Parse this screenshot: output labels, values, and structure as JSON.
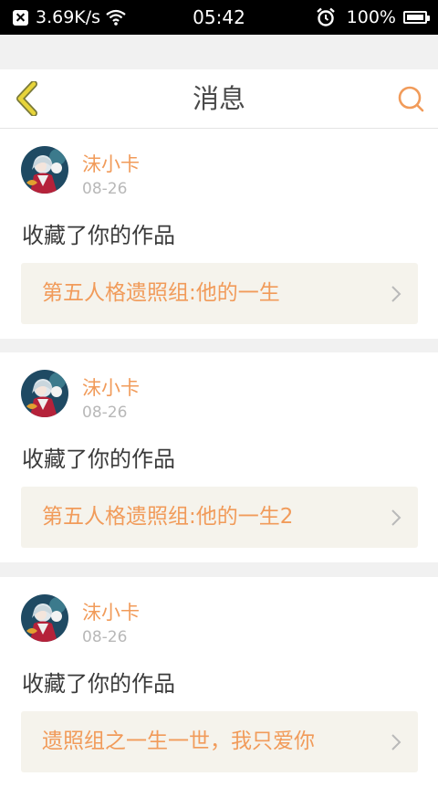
{
  "status_bar": {
    "speed": "3.69K/s",
    "time": "05:42",
    "battery": "100%"
  },
  "header": {
    "title": "消息"
  },
  "messages": [
    {
      "username": "沫小卡",
      "date": "08-26",
      "action": "收藏了你的作品",
      "work_title": "第五人格遗照组:他的一生"
    },
    {
      "username": "沫小卡",
      "date": "08-26",
      "action": "收藏了你的作品",
      "work_title": "第五人格遗照组:他的一生2"
    },
    {
      "username": "沫小卡",
      "date": "08-26",
      "action": "收藏了你的作品",
      "work_title": "遗照组之一生一世，我只爱你"
    }
  ],
  "colors": {
    "accent_orange": "#f19b5a",
    "back_yellow": "#e7d43a",
    "link_background": "#f5f3ec"
  },
  "icons": [
    "close-x-icon",
    "wifi-icon",
    "alarm-icon",
    "battery-icon",
    "back-chevron-icon",
    "search-icon",
    "chevron-right-icon"
  ]
}
